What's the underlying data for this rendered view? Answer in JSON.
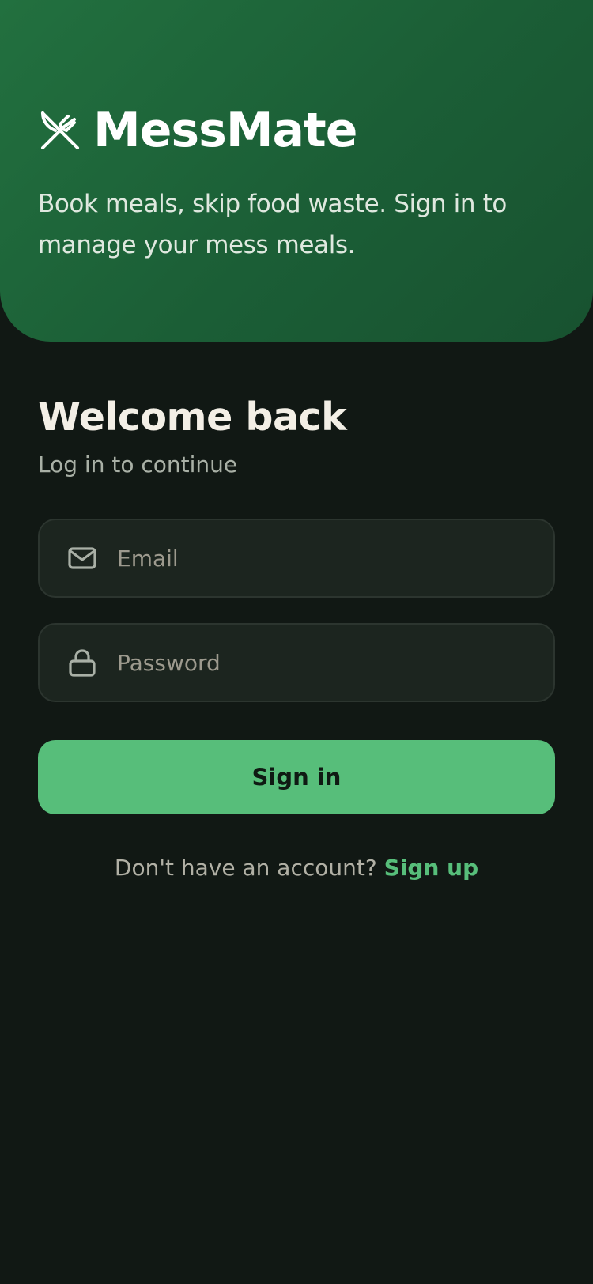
{
  "header": {
    "app_name": "MessMate",
    "tagline": "Book meals, skip food waste. Sign in to manage your mess meals.",
    "logo_icon": "fork-knife-icon"
  },
  "welcome": {
    "title": "Welcome back",
    "subtitle": "Log in to continue"
  },
  "form": {
    "email": {
      "placeholder": "Email",
      "value": "",
      "icon": "mail-icon"
    },
    "password": {
      "placeholder": "Password",
      "value": "",
      "icon": "lock-icon"
    },
    "submit_label": "Sign in"
  },
  "footer": {
    "prompt": "Don't have an account?",
    "link_label": "Sign up"
  },
  "colors": {
    "background": "#111814",
    "hero_green": "#1d6338",
    "accent": "#57be7a",
    "field_bg": "#1c251f"
  }
}
